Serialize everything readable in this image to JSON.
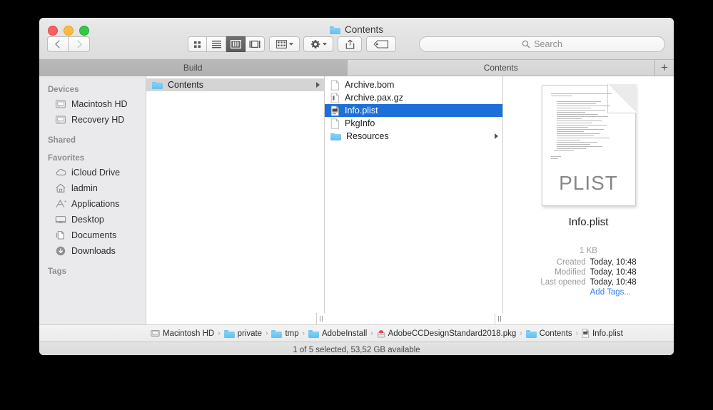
{
  "window": {
    "title": "Contents",
    "traffic_lights": [
      "close",
      "minimize",
      "zoom"
    ]
  },
  "toolbar": {
    "back_label": "Back",
    "forward_label": "Forward",
    "views": [
      {
        "name": "icon-view",
        "label": "Icon View",
        "active": false
      },
      {
        "name": "list-view",
        "label": "List View",
        "active": false
      },
      {
        "name": "column-view",
        "label": "Column View",
        "active": true
      },
      {
        "name": "gallery-view",
        "label": "Gallery View",
        "active": false
      }
    ],
    "arrange_label": "Arrange",
    "action_label": "Action",
    "share_label": "Share",
    "tags_label": "Edit Tags"
  },
  "search": {
    "placeholder": "Search",
    "value": ""
  },
  "tabs": [
    {
      "label": "Build",
      "active": false
    },
    {
      "label": "Contents",
      "active": true
    }
  ],
  "tab_add_label": "+",
  "sidebar": {
    "sections": [
      {
        "header": "Devices",
        "items": [
          {
            "label": "Macintosh HD",
            "icon": "hard-disk-icon"
          },
          {
            "label": "Recovery HD",
            "icon": "hard-disk-icon"
          }
        ]
      },
      {
        "header": "Shared",
        "items": []
      },
      {
        "header": "Favorites",
        "items": [
          {
            "label": "iCloud Drive",
            "icon": "cloud-icon"
          },
          {
            "label": "ladmin",
            "icon": "home-icon"
          },
          {
            "label": "Applications",
            "icon": "applications-icon"
          },
          {
            "label": "Desktop",
            "icon": "desktop-icon"
          },
          {
            "label": "Documents",
            "icon": "documents-icon"
          },
          {
            "label": "Downloads",
            "icon": "downloads-icon"
          }
        ]
      },
      {
        "header": "Tags",
        "items": []
      }
    ]
  },
  "columns": [
    {
      "items": [
        {
          "label": "Contents",
          "icon": "folder-icon",
          "selected": "gray",
          "has_children": true
        }
      ]
    },
    {
      "items": [
        {
          "label": "Archive.bom",
          "icon": "document-icon",
          "selected": "none",
          "has_children": false
        },
        {
          "label": "Archive.pax.gz",
          "icon": "archive-icon",
          "selected": "none",
          "has_children": false
        },
        {
          "label": "Info.plist",
          "icon": "plist-icon",
          "selected": "blue",
          "has_children": false
        },
        {
          "label": "PkgInfo",
          "icon": "document-icon",
          "selected": "none",
          "has_children": false
        },
        {
          "label": "Resources",
          "icon": "folder-icon",
          "selected": "none",
          "has_children": true
        }
      ]
    }
  ],
  "preview": {
    "doc_type_label": "PLIST",
    "name": "Info.plist",
    "size": "1 KB",
    "fields": [
      {
        "key": "Created",
        "value": "Today, 10:48"
      },
      {
        "key": "Modified",
        "value": "Today, 10:48"
      },
      {
        "key": "Last opened",
        "value": "Today, 10:48"
      }
    ],
    "add_tags_label": "Add Tags..."
  },
  "path_bar": {
    "crumbs": [
      {
        "label": "Macintosh HD",
        "icon": "hard-disk-icon"
      },
      {
        "label": "private",
        "icon": "folder-icon"
      },
      {
        "label": "tmp",
        "icon": "folder-icon"
      },
      {
        "label": "AdobeInstall",
        "icon": "folder-icon"
      },
      {
        "label": "AdobeCCDesignStandard2018.pkg",
        "icon": "package-icon"
      },
      {
        "label": "Contents",
        "icon": "folder-icon"
      },
      {
        "label": "Info.plist",
        "icon": "plist-icon"
      }
    ],
    "separator": "›"
  },
  "status": {
    "text": "1 of 5 selected, 53,52 GB available"
  },
  "colors": {
    "selection_blue": "#1e6fd9",
    "folder_blue": "#6ec7f2",
    "link_blue": "#2b7ff5"
  }
}
